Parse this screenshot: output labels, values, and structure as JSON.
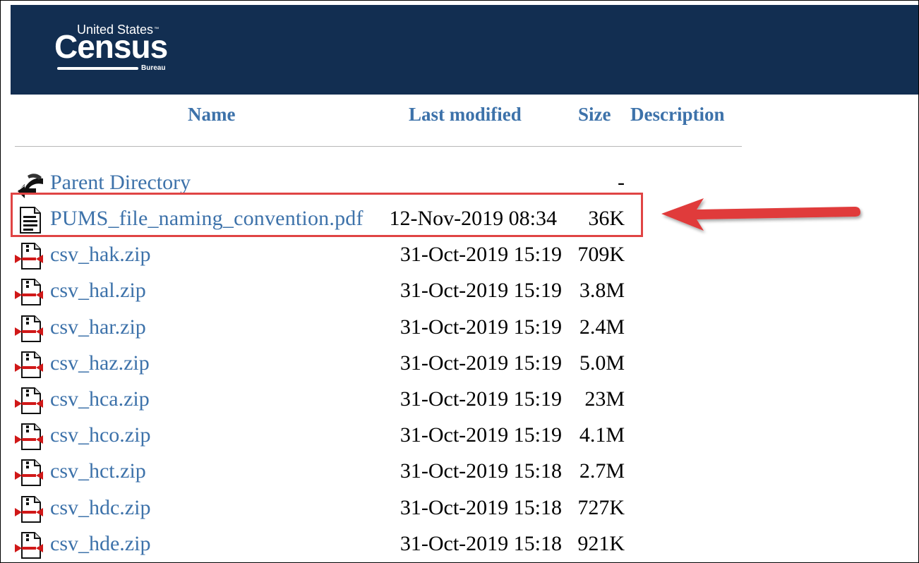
{
  "header": {
    "logo_top": "United States",
    "logo_tm": "™",
    "logo_main": "Census",
    "logo_bureau": "Bureau",
    "background": "#122e51"
  },
  "columns": {
    "name": "Name",
    "last_modified": "Last modified",
    "size": "Size",
    "description": "Description"
  },
  "parent": {
    "label": "Parent Directory",
    "size": "-",
    "icon": "back-arrow-icon"
  },
  "files": [
    {
      "name": "PUMS_file_naming_convention.pdf",
      "date": "12-Nov-2019 08:34",
      "size": "36K",
      "icon": "text-document-icon",
      "highlighted": true
    },
    {
      "name": "csv_hak.zip",
      "date": "31-Oct-2019 15:19",
      "size": "709K",
      "icon": "compressed-file-icon"
    },
    {
      "name": "csv_hal.zip",
      "date": "31-Oct-2019 15:19",
      "size": "3.8M",
      "icon": "compressed-file-icon"
    },
    {
      "name": "csv_har.zip",
      "date": "31-Oct-2019 15:19",
      "size": "2.4M",
      "icon": "compressed-file-icon"
    },
    {
      "name": "csv_haz.zip",
      "date": "31-Oct-2019 15:19",
      "size": "5.0M",
      "icon": "compressed-file-icon"
    },
    {
      "name": "csv_hca.zip",
      "date": "31-Oct-2019 15:19",
      "size": "23M",
      "icon": "compressed-file-icon"
    },
    {
      "name": "csv_hco.zip",
      "date": "31-Oct-2019 15:19",
      "size": "4.1M",
      "icon": "compressed-file-icon"
    },
    {
      "name": "csv_hct.zip",
      "date": "31-Oct-2019 15:18",
      "size": "2.7M",
      "icon": "compressed-file-icon"
    },
    {
      "name": "csv_hdc.zip",
      "date": "31-Oct-2019 15:18",
      "size": "727K",
      "icon": "compressed-file-icon"
    },
    {
      "name": "csv_hde.zip",
      "date": "31-Oct-2019 15:18",
      "size": "921K",
      "icon": "compressed-file-icon"
    }
  ],
  "colors": {
    "link": "#3d72aa",
    "highlight": "#e04444"
  }
}
